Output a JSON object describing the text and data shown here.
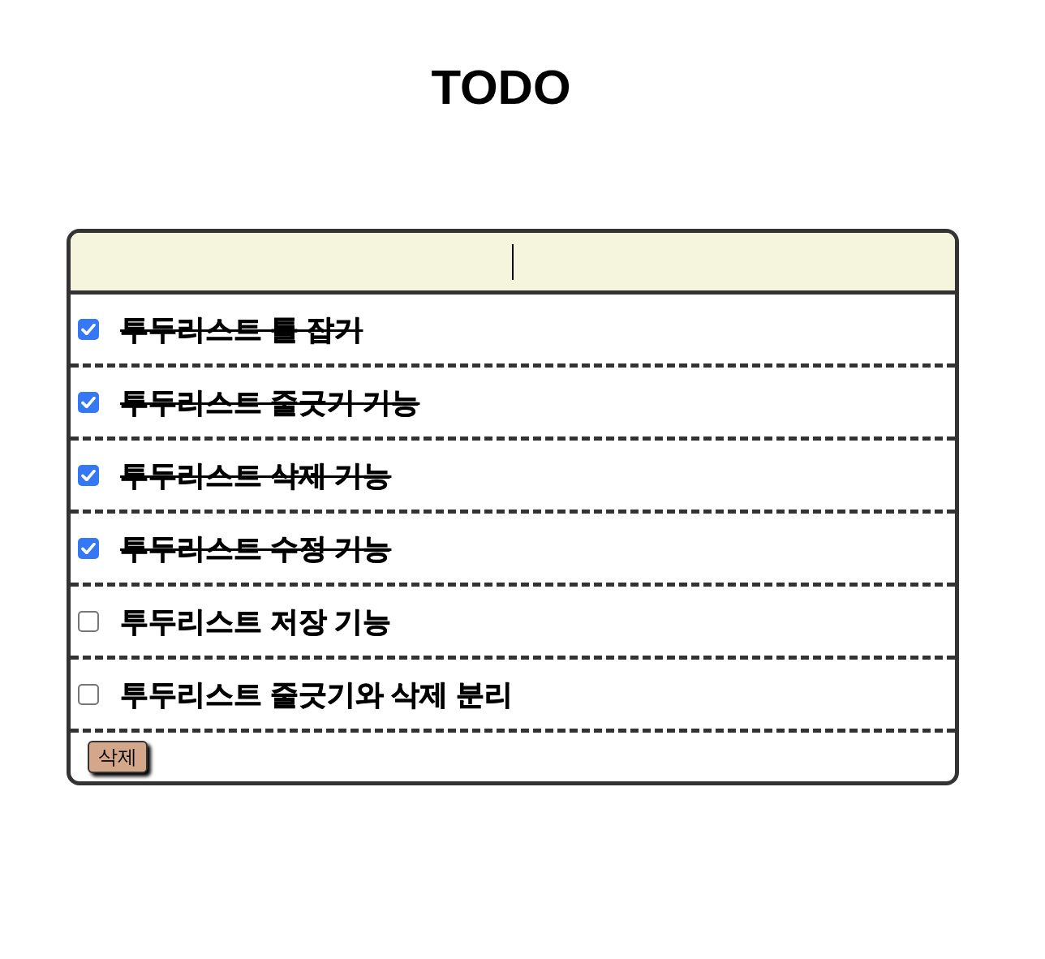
{
  "title": "TODO",
  "input": {
    "focused": true
  },
  "items": [
    {
      "text": "투두리스트 틀 잡기",
      "checked": true
    },
    {
      "text": "투두리스트 줄긋기 기능",
      "checked": true
    },
    {
      "text": "투두리스트 삭제 기능",
      "checked": true
    },
    {
      "text": "투두리스트 수정 기능",
      "checked": true
    },
    {
      "text": "투두리스트 저장 기능",
      "checked": false
    },
    {
      "text": "투두리스트 줄긋기와 삭제 분리",
      "checked": false
    }
  ],
  "delete_button": "삭제"
}
